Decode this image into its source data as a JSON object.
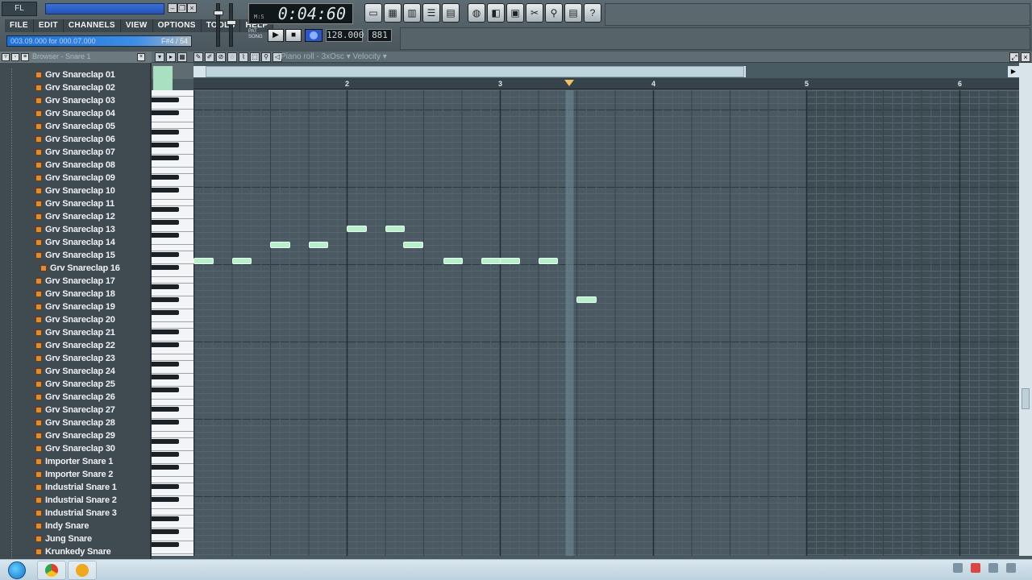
{
  "window": {
    "title": "",
    "logo": "FL"
  },
  "menu": [
    "FILE",
    "EDIT",
    "CHANNELS",
    "VIEW",
    "OPTIONS",
    "TOOLS",
    "HELP"
  ],
  "hint_bar": {
    "left": "003.09.000 for 000.07.000",
    "right": "F#4 / 54"
  },
  "transport": {
    "time": "0:04:60",
    "mode_label": "M:S",
    "pat_label": "PAT",
    "song_label": "SONG",
    "tempo": "128.000",
    "pattern": "881"
  },
  "toolbar_icons": [
    "playlist-icon",
    "step-sequencer-icon",
    "piano-roll-icon",
    "browser-icon",
    "mixer-icon",
    "cpu-icon",
    "tempo-tapper-icon",
    "disk-icon",
    "cut-icon",
    "link-icon",
    "project-info-icon",
    "help-icon"
  ],
  "browser": {
    "title": "Browser - Snare 1",
    "items": [
      "Grv Snareclap 01",
      "Grv Snareclap 02",
      "Grv Snareclap 03",
      "Grv Snareclap 04",
      "Grv Snareclap 05",
      "Grv Snareclap 06",
      "Grv Snareclap 07",
      "Grv Snareclap 08",
      "Grv Snareclap 09",
      "Grv Snareclap 10",
      "Grv Snareclap 11",
      "Grv Snareclap 12",
      "Grv Snareclap 13",
      "Grv Snareclap 14",
      "Grv Snareclap 15",
      "Grv Snareclap 16",
      "Grv Snareclap 17",
      "Grv Snareclap 18",
      "Grv Snareclap 19",
      "Grv Snareclap 20",
      "Grv Snareclap 21",
      "Grv Snareclap 22",
      "Grv Snareclap 23",
      "Grv Snareclap 24",
      "Grv Snareclap 25",
      "Grv Snareclap 26",
      "Grv Snareclap 27",
      "Grv Snareclap 28",
      "Grv Snareclap 29",
      "Grv Snareclap 30",
      "Importer Snare 1",
      "Importer Snare 2",
      "Industrial Snare 1",
      "Industrial Snare 2",
      "Industrial Snare 3",
      "Indy Snare",
      "Jung Snare",
      "Krunkedy Snare"
    ],
    "selected_index": 15
  },
  "piano_roll": {
    "title": "Piano roll - 3xOsc",
    "target": "Velocity",
    "bar_numbers": [
      "2",
      "3",
      "4",
      "5",
      "6"
    ],
    "playhead_bar": 3.45,
    "notes": [
      {
        "start": 1.0,
        "length": 0.13,
        "row": 0
      },
      {
        "start": 1.25,
        "length": 0.13,
        "row": 0
      },
      {
        "start": 1.5,
        "length": 0.13,
        "row": 1
      },
      {
        "start": 1.75,
        "length": 0.13,
        "row": 1
      },
      {
        "start": 2.0,
        "length": 0.13,
        "row": 2
      },
      {
        "start": 2.25,
        "length": 0.13,
        "row": 2
      },
      {
        "start": 2.37,
        "length": 0.13,
        "row": 1
      },
      {
        "start": 2.63,
        "length": 0.13,
        "row": 0
      },
      {
        "start": 2.88,
        "length": 0.13,
        "row": 0
      },
      {
        "start": 3.0,
        "length": 0.13,
        "row": 0
      },
      {
        "start": 3.25,
        "length": 0.13,
        "row": 0
      },
      {
        "start": 3.5,
        "length": 0.13,
        "row": -1
      }
    ]
  },
  "colors": {
    "note": "#b9f0cc",
    "grid_bg": "#4b5a62",
    "grid_dark": "#3f4d54",
    "selected_item": "#e08a3a",
    "transport_display": "#10181c"
  }
}
